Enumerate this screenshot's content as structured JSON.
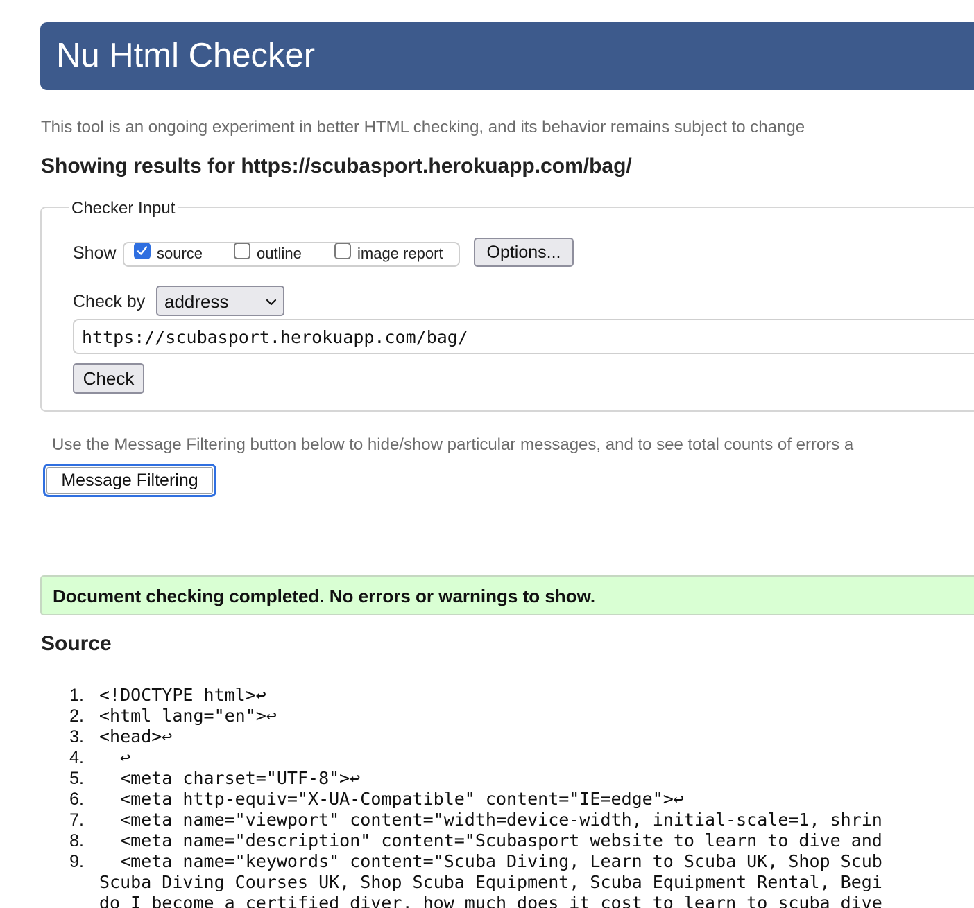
{
  "header": {
    "title": "Nu Html Checker"
  },
  "tagline": "This tool is an ongoing experiment in better HTML checking, and its behavior remains subject to change",
  "results_heading": "Showing results for https://scubasport.herokuapp.com/bag/",
  "checker_input": {
    "legend": "Checker Input",
    "show_label": "Show",
    "show_options": [
      {
        "label": "source",
        "checked": true
      },
      {
        "label": "outline",
        "checked": false
      },
      {
        "label": "image report",
        "checked": false
      }
    ],
    "options_button": "Options...",
    "check_by_label": "Check by",
    "check_by_value": "address",
    "url_value": "https://scubasport.herokuapp.com/bag/",
    "check_button": "Check"
  },
  "filter_note": "Use the Message Filtering button below to hide/show particular messages, and to see total counts of errors a",
  "filter_button": "Message Filtering",
  "status_message": "Document checking completed. No errors or warnings to show.",
  "source": {
    "heading": "Source",
    "lines": [
      {
        "num": "1.",
        "code": "<!DOCTYPE html>↩"
      },
      {
        "num": "2.",
        "code": "<html lang=\"en\">↩"
      },
      {
        "num": "3.",
        "code": "<head>↩"
      },
      {
        "num": "4.",
        "code": "  ↩"
      },
      {
        "num": "5.",
        "code": "  <meta charset=\"UTF-8\">↩"
      },
      {
        "num": "6.",
        "code": "  <meta http-equiv=\"X-UA-Compatible\" content=\"IE=edge\">↩"
      },
      {
        "num": "7.",
        "code": "  <meta name=\"viewport\" content=\"width=device-width, initial-scale=1, shrin"
      },
      {
        "num": "8.",
        "code": "  <meta name=\"description\" content=\"Scubasport website to learn to dive and"
      },
      {
        "num": "9.",
        "code": "  <meta name=\"keywords\" content=\"Scuba Diving, Learn to Scuba UK, Shop Scub"
      }
    ],
    "continuation_lines": [
      "Scuba Diving Courses UK, Shop Scuba Equipment, Scuba Equipment Rental, Begi",
      "do I become a certified diver, how much does it cost to learn to scuba dive"
    ]
  },
  "colors": {
    "banner": "#3d5a8c",
    "checkbox_accent": "#2f6fe0",
    "success_background": "#d9ffd3"
  }
}
